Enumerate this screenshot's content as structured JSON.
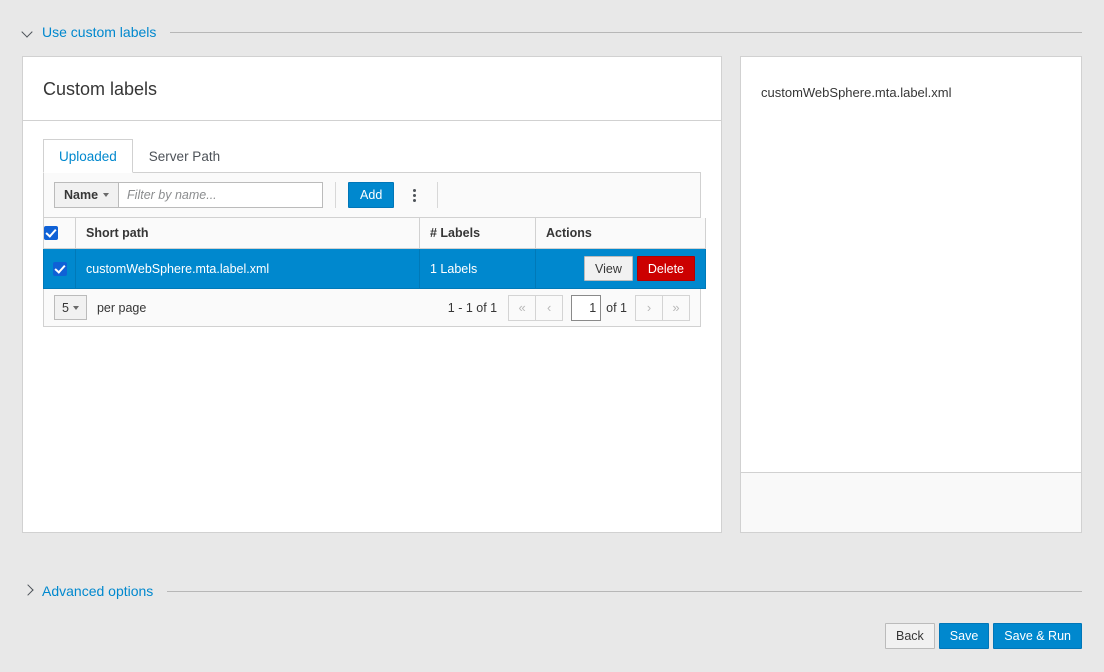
{
  "sections": {
    "custom_labels": {
      "label": "Use custom labels",
      "expanded": true
    },
    "advanced": {
      "label": "Advanced options",
      "expanded": false
    }
  },
  "card": {
    "title": "Custom labels",
    "tabs": [
      {
        "label": "Uploaded",
        "active": true
      },
      {
        "label": "Server Path",
        "active": false
      }
    ],
    "toolbar": {
      "filter_field_label": "Name",
      "filter_placeholder": "Filter by name...",
      "filter_value": "",
      "add_label": "Add",
      "kebab_icon": "kebab-vertical-icon"
    },
    "table": {
      "columns": [
        "Short path",
        "# Labels",
        "Actions"
      ],
      "select_all_checked": true,
      "rows": [
        {
          "checked": true,
          "short_path": "customWebSphere.mta.label.xml",
          "labels": "1 Labels",
          "actions": [
            {
              "label": "View",
              "style": "default"
            },
            {
              "label": "Delete",
              "style": "danger"
            }
          ]
        }
      ]
    },
    "pagination": {
      "per_page_value": "5",
      "per_page_label": "per page",
      "range_label": "1 - 1 of  1",
      "first_icon": "«",
      "prev_icon": "‹",
      "page_value": "1",
      "of_label": "of 1",
      "next_icon": "›",
      "last_icon": "»"
    }
  },
  "preview": {
    "file_name": "customWebSphere.mta.label.xml"
  },
  "footer": {
    "back_label": "Back",
    "save_label": "Save",
    "save_run_label": "Save & Run"
  },
  "colors": {
    "accent": "#0088ce",
    "danger": "#cc0000",
    "page_bg": "#e8e8e8",
    "checkbox": "#0f61d6"
  }
}
